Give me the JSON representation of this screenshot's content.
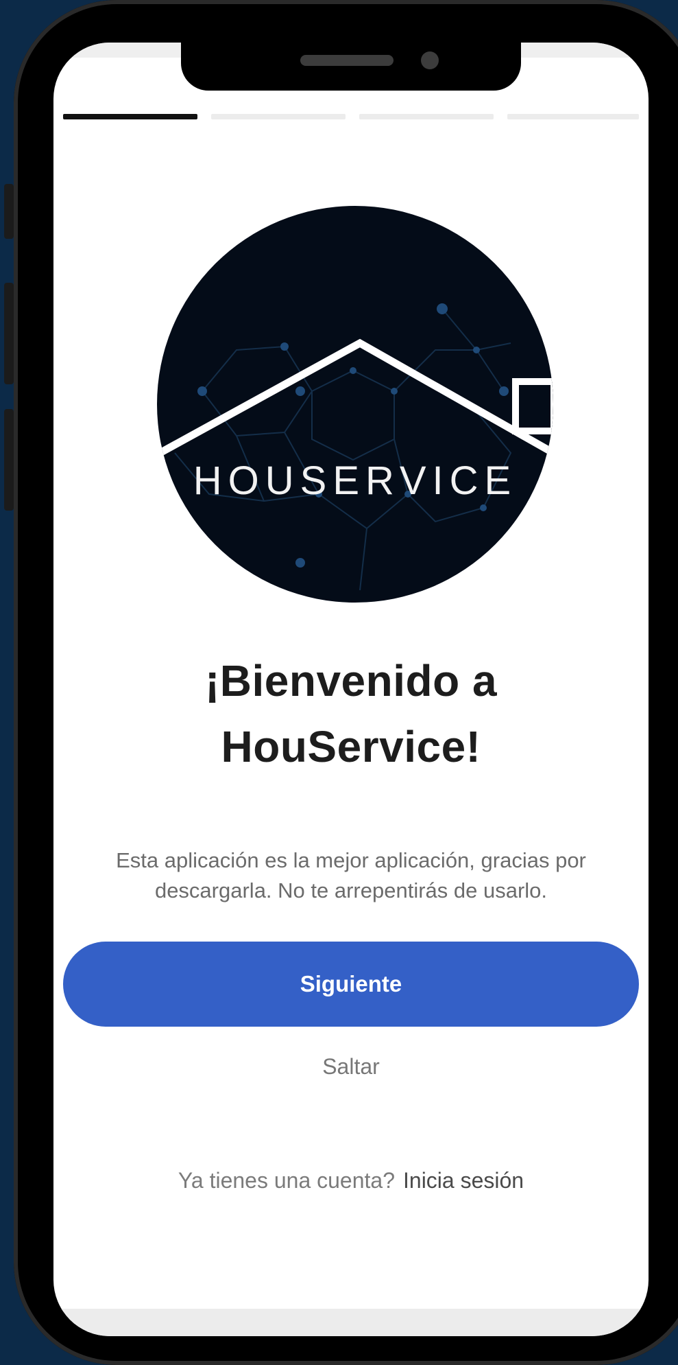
{
  "onboarding": {
    "progress_steps": 4,
    "active_step": 1,
    "logo_text": "HOUSERVICE",
    "title_line1": "¡Bienvenido a",
    "title_line2": "HouService!",
    "description_line1": "Esta aplicación es la mejor aplicación, gracias por",
    "description_line2": "descargarla. No te arrepentirás de usarlo.",
    "next_label": "Siguiente",
    "skip_label": "Saltar",
    "account_prompt": "Ya tienes una cuenta?",
    "login_label": "Inicia sesión"
  },
  "colors": {
    "background": "#0c2a48",
    "primary_button": "#3460c7",
    "logo_background": "#040c18"
  }
}
